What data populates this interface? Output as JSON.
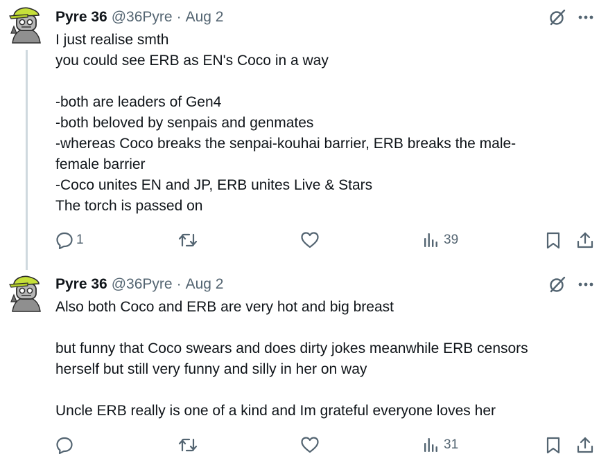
{
  "tweets": [
    {
      "author_name": "Pyre 36",
      "handle": "@36Pyre",
      "separator": "·",
      "date": "Aug 2",
      "lines": [
        "I just realise smth",
        "you could see ERB as EN's Coco in a way",
        "",
        "-both are leaders of Gen4",
        "-both beloved by senpais and genmates",
        "-whereas Coco breaks the senpai-kouhai barrier, ERB breaks the male-",
        "female barrier",
        "-Coco unites EN and JP, ERB unites Live & Stars",
        "The torch is passed on"
      ],
      "actions": {
        "reply_count": "1",
        "retweet_count": "",
        "like_count": "",
        "views_count": "39"
      }
    },
    {
      "author_name": "Pyre 36",
      "handle": "@36Pyre",
      "separator": "·",
      "date": "Aug 2",
      "lines": [
        "Also both Coco and ERB are very hot and big breast",
        "",
        "but funny that Coco swears and does dirty jokes meanwhile ERB censors",
        "herself but still very funny and silly in her on way",
        "",
        "Uncle ERB really is one of a kind and Im grateful everyone loves her"
      ],
      "actions": {
        "reply_count": "",
        "retweet_count": "",
        "like_count": "",
        "views_count": "31"
      }
    }
  ],
  "icons": {
    "avatar": "robot-avatar-icon",
    "grok": "grok-icon",
    "more": "more-icon",
    "reply": "reply-icon",
    "retweet": "retweet-icon",
    "like": "heart-icon",
    "views": "views-icon",
    "bookmark": "bookmark-icon",
    "share": "share-icon"
  },
  "colors": {
    "text": "#0f1419",
    "secondary": "#536471",
    "thread_line": "#cfd9de",
    "avatar_cap": "#c6e03a",
    "avatar_body": "#a3a3a3"
  }
}
